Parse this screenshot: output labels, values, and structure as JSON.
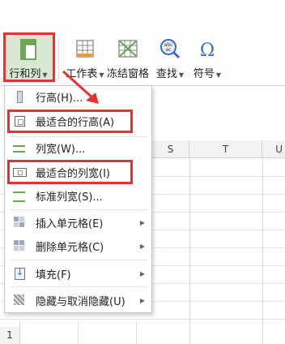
{
  "ribbon": {
    "buttons": [
      {
        "label": "行和列",
        "icon": "rows-columns-icon",
        "has_dropdown": true,
        "active": true
      },
      {
        "label": "工作表",
        "icon": "worksheet-icon",
        "has_dropdown": true
      },
      {
        "label": "冻结窗格",
        "icon": "freeze-panes-icon",
        "has_dropdown": false
      },
      {
        "label": "查找",
        "icon": "find-icon",
        "has_dropdown": true
      },
      {
        "label": "符号",
        "icon": "omega-symbol-icon",
        "has_dropdown": true
      }
    ]
  },
  "columns": [
    "S",
    "T",
    "U"
  ],
  "row_headers": [
    "1"
  ],
  "menu": {
    "items": [
      {
        "label": "行高(H)...",
        "icon": "row-height-icon",
        "submenu": false,
        "highlighted": false
      },
      {
        "label": "最适合的行高(A)",
        "icon": "autofit-row-height-icon",
        "submenu": false,
        "highlighted": true
      },
      {
        "label": "列宽(W)...",
        "icon": "column-width-icon",
        "submenu": false,
        "highlighted": false
      },
      {
        "label": "最适合的列宽(I)",
        "icon": "autofit-column-width-icon",
        "submenu": false,
        "highlighted": true
      },
      {
        "label": "标准列宽(S)...",
        "icon": "standard-column-width-icon",
        "submenu": false,
        "highlighted": false
      },
      {
        "label": "插入单元格(E)",
        "icon": "insert-cells-icon",
        "submenu": true,
        "highlighted": false
      },
      {
        "label": "删除单元格(C)",
        "icon": "delete-cells-icon",
        "submenu": true,
        "highlighted": false
      },
      {
        "label": "填充(F)",
        "icon": "fill-icon",
        "submenu": true,
        "highlighted": false
      },
      {
        "label": "隐藏与取消隐藏(U)",
        "icon": "hide-unhide-icon",
        "submenu": true,
        "highlighted": false
      }
    ]
  },
  "colors": {
    "highlight_box": "#e53333",
    "active_button_bg": "#d9e8d3",
    "ribbon_bg": "#fdfdfd"
  }
}
